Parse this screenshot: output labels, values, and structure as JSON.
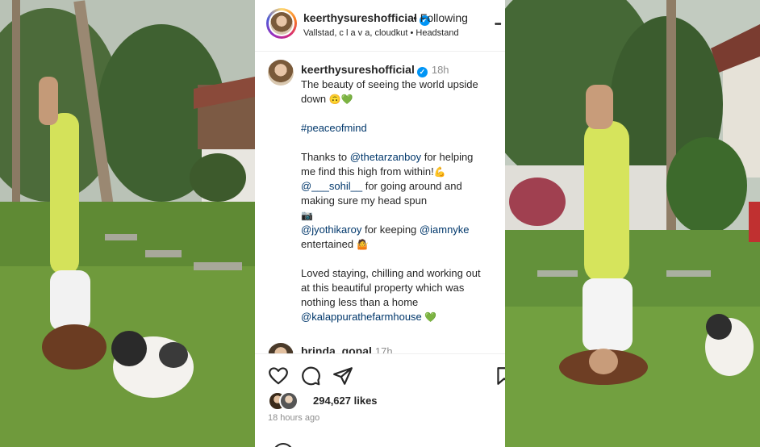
{
  "post": {
    "author": "keerthysureshofficial",
    "follow_status": "Following",
    "follow_separator": "•",
    "subtitle": "Vallstad, c l a v a, cloudkut • Headstand",
    "more_label": "•••"
  },
  "caption": {
    "author": "keerthysureshofficial",
    "time": "18h",
    "lines": [
      "The beauty of seeing the world upside",
      "down",
      "",
      "#peaceofmind",
      "",
      "Thanks to",
      "@thetarzanboy",
      "for helping",
      "me find this high from within!",
      "@___sohil__",
      "for going around and",
      "making sure my head spun",
      "",
      "@jyothikaroy",
      "for keeping",
      "@iamnyke",
      "entertained",
      "",
      "Loved staying, chilling and working out",
      "at this beautiful property which was",
      "nothing less than a home",
      "@kalappurathefarmhouse"
    ]
  },
  "comment": {
    "author": "brinda_gopal",
    "time": "17h"
  },
  "engagement": {
    "likes_count": "294,627",
    "likes_label": "likes",
    "posted_ago": "18 hours ago"
  },
  "icons": {
    "like": "heart-icon",
    "comment": "comment-icon",
    "share": "share-icon",
    "save": "bookmark-icon",
    "verified": "verified-badge-icon",
    "more": "more-options-icon"
  },
  "colors": {
    "link": "#00376b",
    "verified": "#0095f6",
    "muted": "#8e8e8e",
    "text": "#262626"
  }
}
